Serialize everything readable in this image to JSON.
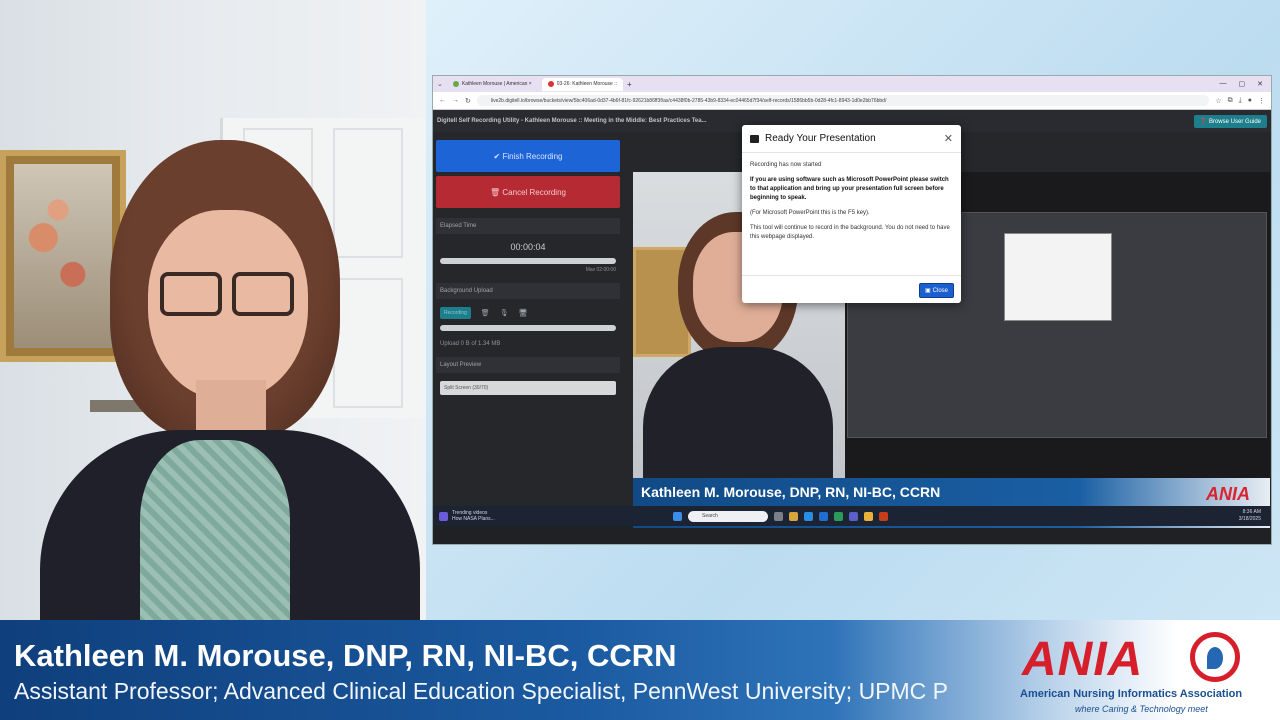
{
  "browser": {
    "tabs": [
      {
        "label": "Kathleen Morouse | American ×",
        "active": false
      },
      {
        "label": "03-26: Kathleen Morouse ::",
        "active": true
      }
    ],
    "new_tab": "+",
    "url": "live2b.digitell.io/browse/buckets/view/5bc406ad-0d37-4b6f-81fc-92621b86ff3f/as/c4438f0b-2785-43b9-8334-ec04465d7f34/self-records/1586bb5b-0d28-4fc1-8943-1d0e2bb76bbd/"
  },
  "app": {
    "title": "Digitell Self Recording Utility - Kathleen Morouse :: Meeting in the Middle: Best Practices Tea...",
    "guide_button": "Browse User Guide",
    "finish_button": "✔ Finish Recording",
    "cancel_button": "🗑 Cancel Recording",
    "elapsed_label": "Elapsed Time",
    "elapsed_value": "00:00:04",
    "max_label": "Max 02:00:00",
    "upload_label": "Background Upload",
    "recording_pill": "Recording",
    "upload_status": "Upload 0 B of 1.34 MB",
    "layout_label": "Layout Preview",
    "layout_value": "Split Screen (30/70)"
  },
  "modal": {
    "title": "Ready Your Presentation",
    "line1": "Recording has now started",
    "line2": "If you are using software such as Microsoft PowerPoint please switch to that application and bring up your presentation full screen before beginning to speak.",
    "line3": "(For Microsoft PowerPoint this is the F5 key).",
    "line4": "This tool will continue to record in the background. You do not need to have this webpage displayed.",
    "close_button": "Close"
  },
  "preview_lower_third": {
    "name": "Kathleen M. Morouse, DNP, RN, NI-BC, CCRN",
    "role": "Assistant Professor; Advanced Clinical Education Specialist, PennWest University; UPMC",
    "logo": "ANIA"
  },
  "taskbar": {
    "news_line1": "Trending videos",
    "news_line2": "How NASA Plans...",
    "search": "Search",
    "time": "8:36 AM",
    "date": "3/18/2025"
  },
  "lower_third": {
    "name": "Kathleen M. Morouse, DNP, RN, NI-BC, CCRN",
    "role": "Assistant Professor; Advanced Clinical Education Specialist, PennWest University; UPMC P",
    "logo_word": "ANIA",
    "logo_sub": "American Nursing Informatics Association",
    "logo_tagline": "where Caring & Technology meet"
  },
  "colors": {
    "brand_red": "#d61f2b",
    "brand_blue": "#1a4f91",
    "finish_blue": "#1d64d6",
    "cancel_red": "#b62a33",
    "accent_teal": "#1e7f8c"
  }
}
